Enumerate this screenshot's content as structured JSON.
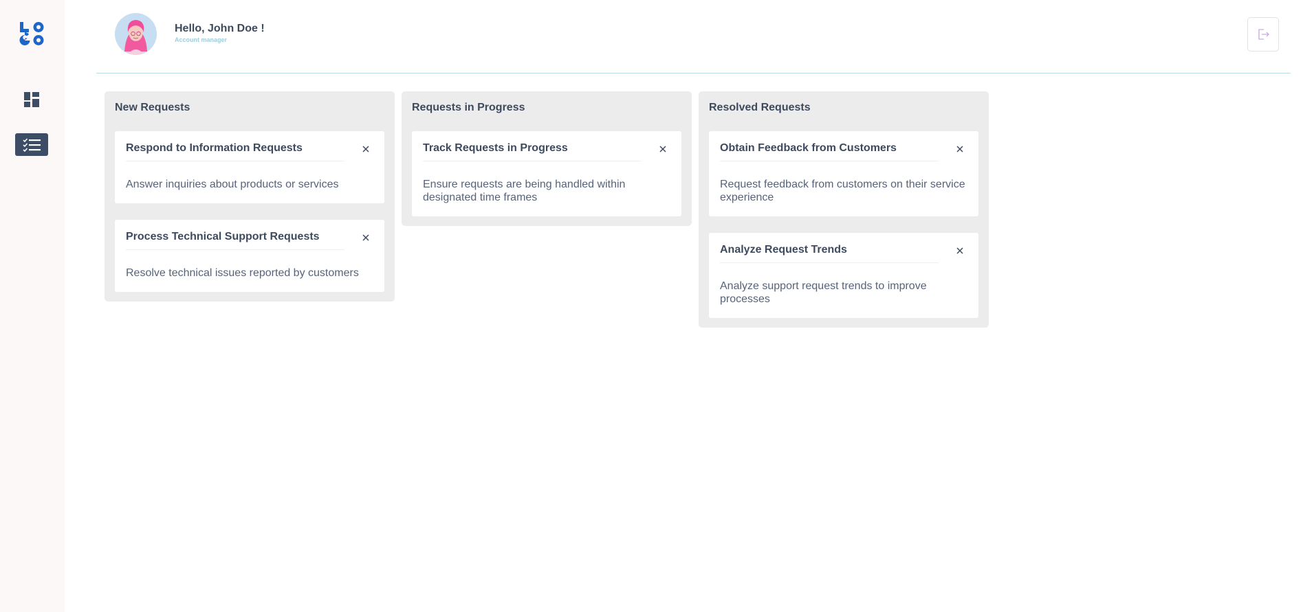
{
  "app": {
    "logo_alt": "LOGO"
  },
  "header": {
    "greeting": "Hello, John Doe !",
    "role": "Account manager"
  },
  "board": {
    "columns": [
      {
        "title": "New Requests",
        "cards": [
          {
            "title": "Respond to Information Requests",
            "description": "Answer inquiries about products or services"
          },
          {
            "title": "Process Technical Support Requests",
            "description": "Resolve technical issues reported by customers"
          }
        ]
      },
      {
        "title": "Requests in Progress",
        "cards": [
          {
            "title": "Track Requests in Progress",
            "description": "Ensure requests are being handled within designated time frames"
          }
        ]
      },
      {
        "title": "Resolved Requests",
        "cards": [
          {
            "title": "Obtain Feedback from Customers",
            "description": "Request feedback from customers on their service experience"
          },
          {
            "title": "Analyze Request Trends",
            "description": "Analyze support request trends to improve processes"
          }
        ]
      }
    ]
  },
  "colors": {
    "logo": "#1d67c9",
    "active_nav": "#3c4d65",
    "column_bg": "#ececec",
    "header_border": "#b9e1e3",
    "logout_icon": "#c9a8e6"
  }
}
